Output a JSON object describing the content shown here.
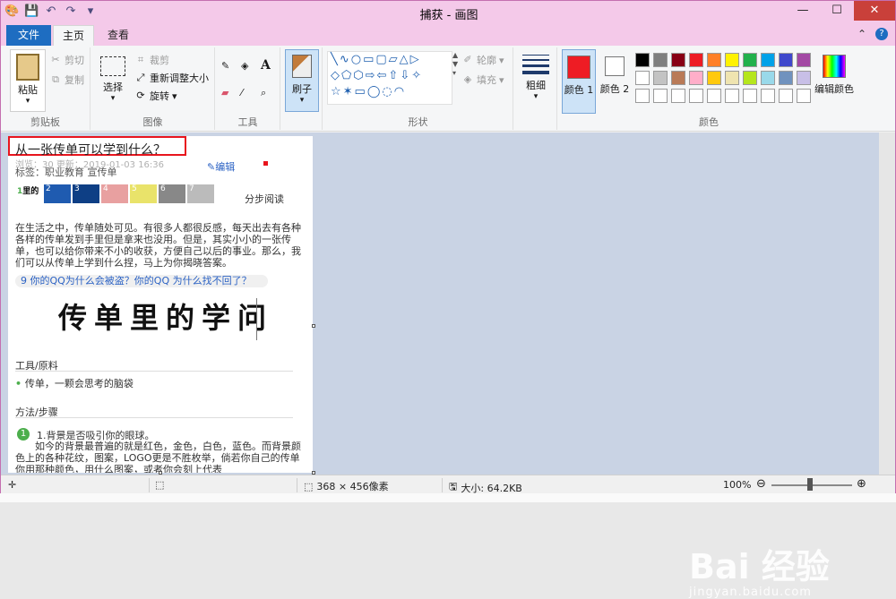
{
  "window": {
    "title": "捕获 - 画图",
    "minimize": "—",
    "maximize": "☐",
    "close": "✕"
  },
  "tabs": {
    "file": "文件",
    "home": "主页",
    "view": "查看"
  },
  "ribbon": {
    "clipboard": {
      "label": "剪贴板",
      "paste": "粘贴",
      "cut": "剪切",
      "copy": "复制"
    },
    "image": {
      "label": "图像",
      "select": "选择",
      "crop": "裁剪",
      "resize": "重新调整大小",
      "rotate": "旋转"
    },
    "tools": {
      "label": "工具"
    },
    "brushes": {
      "label": "刷子"
    },
    "shapes": {
      "label": "形状",
      "outline": "轮廓",
      "fill": "填充"
    },
    "size": {
      "label": "粗细"
    },
    "colors": {
      "label": "颜色",
      "color1": "颜色 1",
      "color2": "颜色 2",
      "edit": "编辑颜色",
      "color1_value": "#ee1c24",
      "color2_value": "#ffffff",
      "palette_row1": [
        "#000000",
        "#7f7f7f",
        "#880015",
        "#ed1c24",
        "#ff7f27",
        "#fff200",
        "#22b14c",
        "#00a2e8",
        "#3f48cc",
        "#a349a4"
      ],
      "palette_row2": [
        "#ffffff",
        "#c3c3c3",
        "#b97a57",
        "#ffaec9",
        "#ffc90e",
        "#efe4b0",
        "#b5e61d",
        "#99d9ea",
        "#7092be",
        "#c8bfe7"
      ]
    }
  },
  "document": {
    "title": "从一张传单可以学到什么？",
    "meta": "浏览：30  更新：2019-01-03 16:36",
    "tags": "标签：职业教育 宣传单",
    "edit": "编辑",
    "thumb_nums": [
      "1",
      "2",
      "3",
      "4",
      "5",
      "6",
      "7"
    ],
    "thumb_prefix": "里的",
    "step_read": "分步阅读",
    "intro": "在生活之中，传单随处可见。有很多人都很反感，每天出去有各种各样的传单发到手里但是拿来也没用。但是，其实小小的一张传单，也可以给你带来不小的收获，方便自己以后的事业。那么，我们可以从传单上学到什么捏，马上为你揭晓答案。",
    "link": "9  你的QQ为什么会被盗？你的QQ 为什么找不回了？",
    "calligraphy": "传单里的学问",
    "tools_heading": "工具/原料",
    "tools_item": "传单，一颗会思考的脑袋",
    "steps_heading": "方法/步骤",
    "step1_num": "1",
    "step1_title": "1.背景是否吸引你的眼球。",
    "step1_body": "如今的背景最普遍的就是红色，金色，白色，蓝色。而背景颜色上的各种花纹，图案，LOGO更是不胜枚举，倘若你自己的传单你用那种颜色，用什么图案，或者你会刻上代表"
  },
  "watermark": {
    "logo": "Bai 经验",
    "url": "jingyan.baidu.com"
  },
  "status": {
    "dimensions": "368 × 456像素",
    "size": "大小: 64.2KB",
    "zoom": "100%"
  }
}
